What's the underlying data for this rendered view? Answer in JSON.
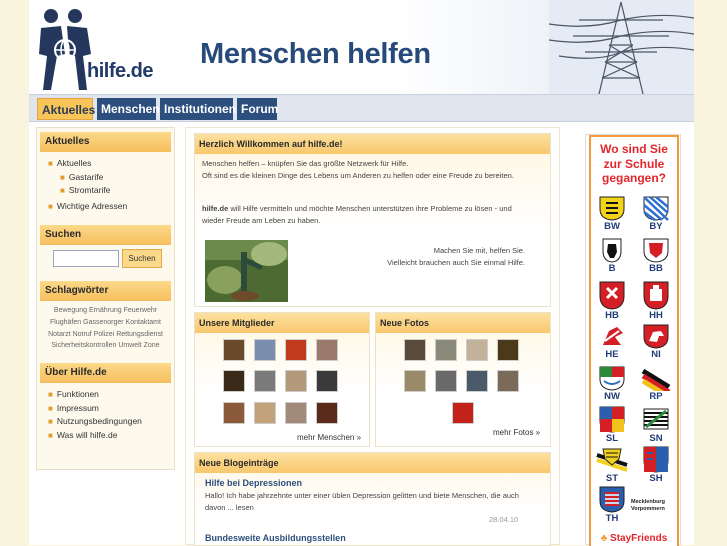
{
  "header": {
    "logo_text": "hilfe.de",
    "slogan": "Menschen helfen"
  },
  "nav": {
    "tabs": [
      "Aktuelles",
      "Menschen",
      "Institutionen",
      "Forum"
    ],
    "active": "Aktuelles"
  },
  "sidebar": {
    "aktuelles": {
      "title": "Aktuelles",
      "items": [
        "Aktuelles",
        "Gastarife",
        "Stromtarife",
        "Wichtige Adressen"
      ]
    },
    "suchen": {
      "title": "Suchen",
      "input_value": "",
      "button_label": "Suchen"
    },
    "schlagwoerter": {
      "title": "Schlagwörter",
      "tags": [
        "Bewegung",
        "Ernährung",
        "Feuerwehr",
        "Flughäfen",
        "Gassenorger",
        "Kontaktamt",
        "Notarzt",
        "Notruf",
        "Polizei",
        "Rettungsdienst",
        "Sicherheitskontrollen",
        "Umwelt",
        "Zone"
      ]
    },
    "ueber": {
      "title": "Über Hilfe.de",
      "items": [
        "Funktionen",
        "Impressum",
        "Nutzungsbedingungen",
        "Was will hilfe.de"
      ]
    }
  },
  "welcome": {
    "title": "Herzlich Willkommen auf hilfe.de!",
    "p1_line1": "Menschen helfen – knüpfen Sie das größte Netzwerk für Hilfe.",
    "p1_line2": "Oft sind es die kleinen Dinge des Lebens um Anderen zu helfen oder eine Freude zu bereiten.",
    "p2_strong": "hilfe.de",
    "p2_rest": " will Hilfe vermitteln und möchte Menschen unterstützen ihre Probleme zu lösen - und wieder Freude am Leben zu haben.",
    "cta_line1": "Machen Sie mit, helfen Sie.",
    "cta_line2": "Vielleicht brauchen auch Sie einmal Hilfe."
  },
  "members": {
    "title": "Unsere Mitglieder",
    "more": "mehr Menschen »"
  },
  "photos": {
    "title": "Neue Fotos",
    "more": "mehr Fotos »"
  },
  "blog": {
    "title": "Neue Blogeinträge",
    "entries": [
      {
        "title": "Hilfe bei Depressionen",
        "excerpt": "Hallo! Ich habe jahrzehnte unter einer üblen Depression gelitten und biete Menschen, die auch davon ... lesen",
        "date": "28.04.10"
      },
      {
        "title": "Bundesweite Ausbildungsstellen",
        "excerpt": "",
        "date": ""
      }
    ]
  },
  "ad": {
    "headline_l1": "Wo sind Sie",
    "headline_l2": "zur Schule",
    "headline_l3": "gegangen?",
    "states": [
      "BW",
      "BY",
      "B",
      "BB",
      "HB",
      "HH",
      "HE",
      "NI",
      "NW",
      "RP",
      "SL",
      "SN",
      "ST",
      "SH",
      "TH"
    ],
    "mv_label_1": "Mecklenburg",
    "mv_label_2": "Vorpommern",
    "brand": "StayFriends"
  },
  "colors": {
    "page_bg": "#f8f4dd",
    "nav_blue": "#2c4f7d",
    "accent_orange": "#f7c55a",
    "ad_red": "#e2262b"
  }
}
